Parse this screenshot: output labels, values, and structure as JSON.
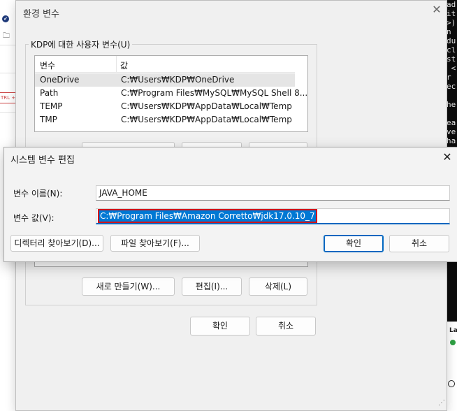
{
  "env_window": {
    "title": "환경 변수",
    "user_vars_group_label": "KDP에 대한 사용자 변수(U)",
    "columns": [
      "변수",
      "값"
    ],
    "rows": [
      {
        "name": "OneDrive",
        "value": "C:₩Users₩KDP₩OneDrive"
      },
      {
        "name": "Path",
        "value": "C:₩Program Files₩MySQL₩MySQL Shell 8...."
      },
      {
        "name": "TEMP",
        "value": "C:₩Users₩KDP₩AppData₩Local₩Temp"
      },
      {
        "name": "TMP",
        "value": "C:₩Users₩KDP₩AppData₩Local₩Temp"
      }
    ],
    "system_buttons": {
      "new": "새로 만들기(W)...",
      "edit": "편집(I)...",
      "delete": "삭제(L)"
    },
    "ok": "확인",
    "cancel": "취소"
  },
  "edit_dialog": {
    "title": "시스템 변수 편집",
    "name_label": "변수 이름(N):",
    "name_value": "JAVA_HOME",
    "value_label": "변수 값(V):",
    "value_value": "C:₩Program Files₩Amazon Corretto₩jdk17.0.10_7",
    "browse_dir": "디렉터리 찾아보기(D)...",
    "browse_file": "파일 찾아보기(F)...",
    "ok": "확인",
    "cancel": "취소"
  },
  "terminal_lines": [
    "ad",
    "it",
    ">)",
    "n",
    "du",
    "cl",
    "st",
    " <",
    "r",
    "ec",
    "",
    "he",
    "",
    "ea",
    "ve",
    "ha",
    "k"
  ],
  "colors": {
    "accent": "#0067c0",
    "selection": "#0078d4",
    "highlight_box": "#d0141b",
    "status_green": "#2ea043"
  },
  "background_right": {
    "label": "La"
  }
}
